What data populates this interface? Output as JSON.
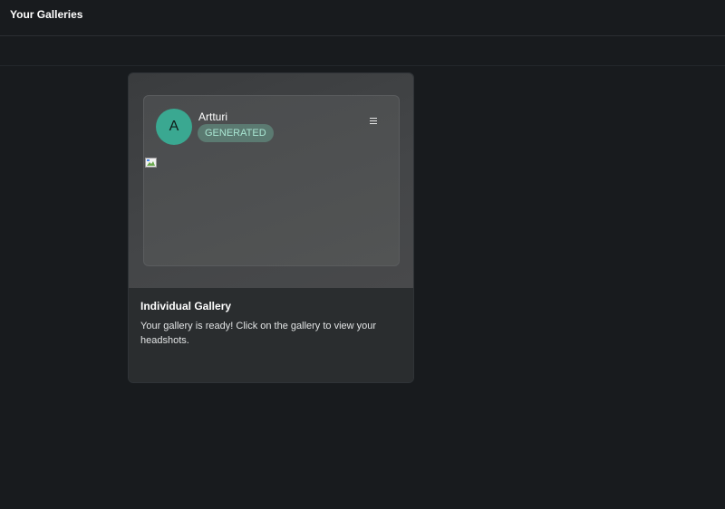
{
  "header": {
    "title": "Your Galleries"
  },
  "galleries": [
    {
      "avatar_initial": "A",
      "name": "Artturi",
      "status": "GENERATED",
      "menu_icon": "hamburger-menu-icon",
      "card_title": "Individual Gallery",
      "card_description": "Your gallery is ready! Click on the gallery to view your headshots."
    }
  ],
  "colors": {
    "background": "#181b1e",
    "avatar": "#3aa891",
    "badge_bg": "#5b7a71",
    "badge_text": "#a9e6d2"
  }
}
